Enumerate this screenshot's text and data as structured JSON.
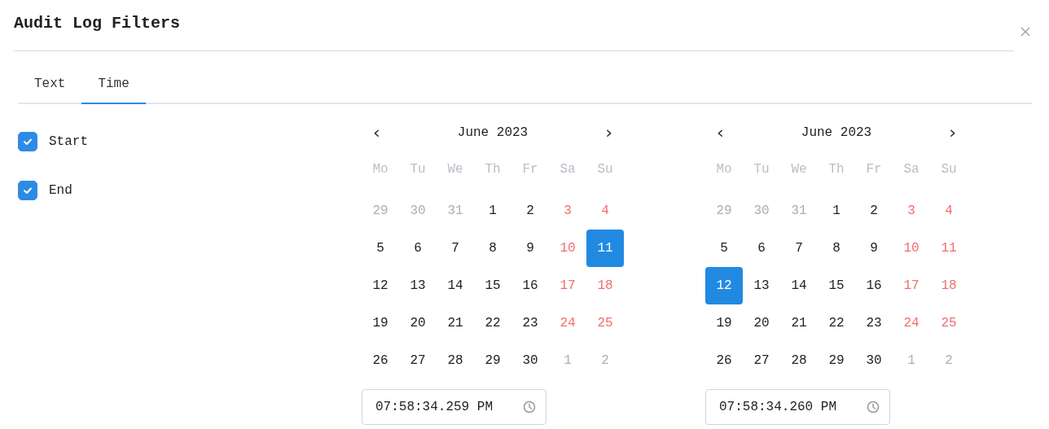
{
  "title": "Audit Log Filters",
  "tabs": [
    {
      "label": "Text",
      "selected": false
    },
    {
      "label": "Time",
      "selected": true
    }
  ],
  "toggles": [
    {
      "label": "Start",
      "checked": true
    },
    {
      "label": "End",
      "checked": true
    }
  ],
  "calendars": [
    {
      "prev": "‹",
      "next": "›",
      "month": "June 2023",
      "weekdays": [
        "Mo",
        "Tu",
        "We",
        "Th",
        "Fr",
        "Sa",
        "Su"
      ],
      "weeks": [
        [
          {
            "day": "29",
            "kind": "outside",
            "selected": false
          },
          {
            "day": "30",
            "kind": "outside",
            "selected": false
          },
          {
            "day": "31",
            "kind": "outside",
            "selected": false
          },
          {
            "day": "1",
            "kind": "weekday",
            "selected": false
          },
          {
            "day": "2",
            "kind": "weekday",
            "selected": false
          },
          {
            "day": "3",
            "kind": "weekend",
            "selected": false
          },
          {
            "day": "4",
            "kind": "weekend",
            "selected": false
          }
        ],
        [
          {
            "day": "5",
            "kind": "weekday",
            "selected": false
          },
          {
            "day": "6",
            "kind": "weekday",
            "selected": false
          },
          {
            "day": "7",
            "kind": "weekday",
            "selected": false
          },
          {
            "day": "8",
            "kind": "weekday",
            "selected": false
          },
          {
            "day": "9",
            "kind": "weekday",
            "selected": false
          },
          {
            "day": "10",
            "kind": "weekend",
            "selected": false
          },
          {
            "day": "11",
            "kind": "weekend",
            "selected": true
          }
        ],
        [
          {
            "day": "12",
            "kind": "weekday",
            "selected": false
          },
          {
            "day": "13",
            "kind": "weekday",
            "selected": false
          },
          {
            "day": "14",
            "kind": "weekday",
            "selected": false
          },
          {
            "day": "15",
            "kind": "weekday",
            "selected": false
          },
          {
            "day": "16",
            "kind": "weekday",
            "selected": false
          },
          {
            "day": "17",
            "kind": "weekend",
            "selected": false
          },
          {
            "day": "18",
            "kind": "weekend",
            "selected": false
          }
        ],
        [
          {
            "day": "19",
            "kind": "weekday",
            "selected": false
          },
          {
            "day": "20",
            "kind": "weekday",
            "selected": false
          },
          {
            "day": "21",
            "kind": "weekday",
            "selected": false
          },
          {
            "day": "22",
            "kind": "weekday",
            "selected": false
          },
          {
            "day": "23",
            "kind": "weekday",
            "selected": false
          },
          {
            "day": "24",
            "kind": "weekend",
            "selected": false
          },
          {
            "day": "25",
            "kind": "weekend",
            "selected": false
          }
        ],
        [
          {
            "day": "26",
            "kind": "weekday",
            "selected": false
          },
          {
            "day": "27",
            "kind": "weekday",
            "selected": false
          },
          {
            "day": "28",
            "kind": "weekday",
            "selected": false
          },
          {
            "day": "29",
            "kind": "weekday",
            "selected": false
          },
          {
            "day": "30",
            "kind": "weekday",
            "selected": false
          },
          {
            "day": "1",
            "kind": "outside",
            "selected": false
          },
          {
            "day": "2",
            "kind": "outside",
            "selected": false
          }
        ]
      ],
      "time": "07:58:34.259 PM"
    },
    {
      "prev": "‹",
      "next": "›",
      "month": "June 2023",
      "weekdays": [
        "Mo",
        "Tu",
        "We",
        "Th",
        "Fr",
        "Sa",
        "Su"
      ],
      "weeks": [
        [
          {
            "day": "29",
            "kind": "outside",
            "selected": false
          },
          {
            "day": "30",
            "kind": "outside",
            "selected": false
          },
          {
            "day": "31",
            "kind": "outside",
            "selected": false
          },
          {
            "day": "1",
            "kind": "weekday",
            "selected": false
          },
          {
            "day": "2",
            "kind": "weekday",
            "selected": false
          },
          {
            "day": "3",
            "kind": "weekend",
            "selected": false
          },
          {
            "day": "4",
            "kind": "weekend",
            "selected": false
          }
        ],
        [
          {
            "day": "5",
            "kind": "weekday",
            "selected": false
          },
          {
            "day": "6",
            "kind": "weekday",
            "selected": false
          },
          {
            "day": "7",
            "kind": "weekday",
            "selected": false
          },
          {
            "day": "8",
            "kind": "weekday",
            "selected": false
          },
          {
            "day": "9",
            "kind": "weekday",
            "selected": false
          },
          {
            "day": "10",
            "kind": "weekend",
            "selected": false
          },
          {
            "day": "11",
            "kind": "weekend",
            "selected": false
          }
        ],
        [
          {
            "day": "12",
            "kind": "weekday",
            "selected": true
          },
          {
            "day": "13",
            "kind": "weekday",
            "selected": false
          },
          {
            "day": "14",
            "kind": "weekday",
            "selected": false
          },
          {
            "day": "15",
            "kind": "weekday",
            "selected": false
          },
          {
            "day": "16",
            "kind": "weekday",
            "selected": false
          },
          {
            "day": "17",
            "kind": "weekend",
            "selected": false
          },
          {
            "day": "18",
            "kind": "weekend",
            "selected": false
          }
        ],
        [
          {
            "day": "19",
            "kind": "weekday",
            "selected": false
          },
          {
            "day": "20",
            "kind": "weekday",
            "selected": false
          },
          {
            "day": "21",
            "kind": "weekday",
            "selected": false
          },
          {
            "day": "22",
            "kind": "weekday",
            "selected": false
          },
          {
            "day": "23",
            "kind": "weekday",
            "selected": false
          },
          {
            "day": "24",
            "kind": "weekend",
            "selected": false
          },
          {
            "day": "25",
            "kind": "weekend",
            "selected": false
          }
        ],
        [
          {
            "day": "26",
            "kind": "weekday",
            "selected": false
          },
          {
            "day": "27",
            "kind": "weekday",
            "selected": false
          },
          {
            "day": "28",
            "kind": "weekday",
            "selected": false
          },
          {
            "day": "29",
            "kind": "weekday",
            "selected": false
          },
          {
            "day": "30",
            "kind": "weekday",
            "selected": false
          },
          {
            "day": "1",
            "kind": "outside",
            "selected": false
          },
          {
            "day": "2",
            "kind": "outside",
            "selected": false
          }
        ]
      ],
      "time": "07:58:34.260 PM"
    }
  ]
}
